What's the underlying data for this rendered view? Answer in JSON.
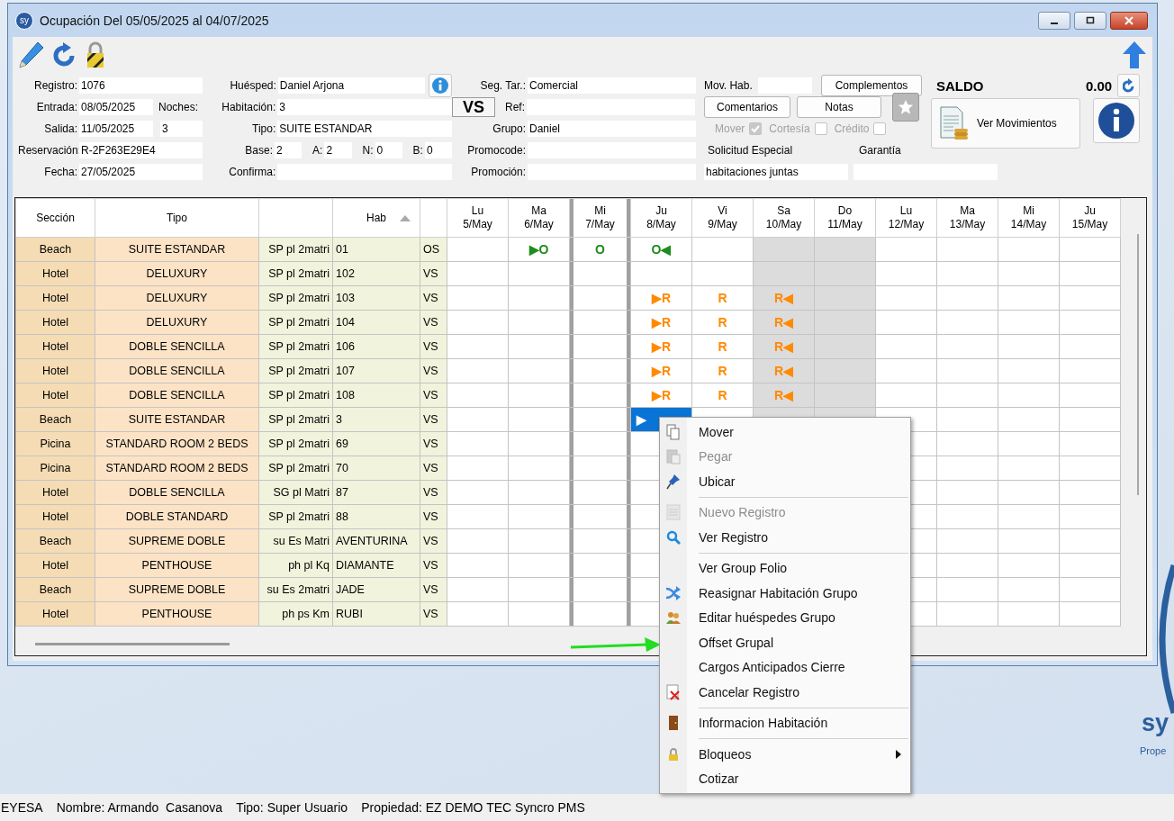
{
  "window": {
    "badge": "sy",
    "title": "Ocupación Del 05/05/2025 al 04/07/2025"
  },
  "form": {
    "registro": {
      "label": "Registro:",
      "value": "1076"
    },
    "entrada": {
      "label": "Entrada:",
      "value": "08/05/2025"
    },
    "noches": {
      "label": "Noches:",
      "value": "3"
    },
    "salida": {
      "label": "Salida:",
      "value": "11/05/2025"
    },
    "reservacion": {
      "label": "Reservación:",
      "value": "R-2F263E29E4"
    },
    "fecha": {
      "label": "Fecha:",
      "value": "27/05/2025"
    },
    "huesped": {
      "label": "Huésped:",
      "value": "Daniel Arjona"
    },
    "habitacion": {
      "label": "Habitación:",
      "value": "3"
    },
    "tipo": {
      "label": "Tipo:",
      "value": "SUITE ESTANDAR"
    },
    "occupancy": [
      {
        "label": "Base:",
        "value": "2"
      },
      {
        "label": "A:",
        "value": "2"
      },
      {
        "label": "N:",
        "value": "0"
      },
      {
        "label": "B:",
        "value": "0"
      }
    ],
    "confirma": {
      "label": "Confirma:"
    },
    "seg_tar": {
      "label": "Seg. Tar.:",
      "value": "Comercial"
    },
    "status_code": "VS",
    "ref": {
      "label": "Ref:"
    },
    "grupo": {
      "label": "Grupo:",
      "value": "Daniel"
    },
    "promocode": {
      "label": "Promocode:"
    },
    "promocion": {
      "label": "Promoción:"
    },
    "mov_hab": {
      "label": "Mov. Hab."
    },
    "buttons": {
      "complementos": "Complementos",
      "comentarios": "Comentarios",
      "notas": "Notas",
      "ver_movimientos": "Ver Movimientos"
    },
    "checks": [
      {
        "label": "Mover",
        "checked": true,
        "disabled": true
      },
      {
        "label": "Cortesía",
        "checked": false,
        "disabled": true
      },
      {
        "label": "Crédito",
        "checked": false,
        "disabled": true
      }
    ],
    "solicitud": {
      "label": "Solicitud Especial",
      "value": "habitaciones juntas"
    },
    "garantia": {
      "label": "Garantía"
    },
    "saldo": {
      "label": "SALDO",
      "value": "0.00"
    }
  },
  "grid": {
    "columns": {
      "seccion": "Sección",
      "tipo": "Tipo",
      "hab": {
        "label": "Hab",
        "sorted": true
      }
    },
    "days": [
      {
        "weekday": "Lu",
        "date": "5/May",
        "weekend": false,
        "marked": false
      },
      {
        "weekday": "Ma",
        "date": "6/May",
        "weekend": false,
        "marked": false
      },
      {
        "weekday": "Mi",
        "date": "7/May",
        "weekend": false,
        "marked": true
      },
      {
        "weekday": "Ju",
        "date": "8/May",
        "weekend": false,
        "marked": false
      },
      {
        "weekday": "Vi",
        "date": "9/May",
        "weekend": false,
        "marked": false
      },
      {
        "weekday": "Sa",
        "date": "10/May",
        "weekend": true,
        "marked": false
      },
      {
        "weekday": "Do",
        "date": "11/May",
        "weekend": true,
        "marked": false
      },
      {
        "weekday": "Lu",
        "date": "12/May",
        "weekend": false,
        "marked": false
      },
      {
        "weekday": "Ma",
        "date": "13/May",
        "weekend": false,
        "marked": false
      },
      {
        "weekday": "Mi",
        "date": "14/May",
        "weekend": false,
        "marked": false
      },
      {
        "weekday": "Ju",
        "date": "15/May",
        "weekend": false,
        "marked": false
      }
    ],
    "rows": [
      {
        "seccion": "Beach",
        "tipo": "SUITE ESTANDAR",
        "column_3": "SP pl 2matri",
        "hab": "01",
        "column_5": "OS",
        "booking": {
          "color": "#1e8c1e",
          "selected": false,
          "cells": [
            "",
            "▶O",
            "O",
            "O◀"
          ]
        }
      },
      {
        "seccion": "Hotel",
        "tipo": "DELUXURY",
        "column_3": "SP pl 2matri",
        "hab": "102",
        "column_5": "VS"
      },
      {
        "seccion": "Hotel",
        "tipo": "DELUXURY",
        "column_3": "SP pl 2matri",
        "hab": "103",
        "column_5": "VS",
        "booking": {
          "color": "#ff8a00",
          "selected": false,
          "cells": [
            "",
            "",
            "",
            "▶R",
            "R",
            "R◀"
          ]
        }
      },
      {
        "seccion": "Hotel",
        "tipo": "DELUXURY",
        "column_3": "SP pl 2matri",
        "hab": "104",
        "column_5": "VS",
        "booking": {
          "color": "#ff8a00",
          "selected": false,
          "cells": [
            "",
            "",
            "",
            "▶R",
            "R",
            "R◀"
          ]
        }
      },
      {
        "seccion": "Hotel",
        "tipo": "DOBLE SENCILLA",
        "column_3": "SP pl 2matri",
        "hab": "106",
        "column_5": "VS",
        "booking": {
          "color": "#ff8a00",
          "selected": false,
          "cells": [
            "",
            "",
            "",
            "▶R",
            "R",
            "R◀"
          ]
        }
      },
      {
        "seccion": "Hotel",
        "tipo": "DOBLE SENCILLA",
        "column_3": "SP pl 2matri",
        "hab": "107",
        "column_5": "VS",
        "booking": {
          "color": "#ff8a00",
          "selected": false,
          "cells": [
            "",
            "",
            "",
            "▶R",
            "R",
            "R◀"
          ]
        }
      },
      {
        "seccion": "Hotel",
        "tipo": "DOBLE SENCILLA",
        "column_3": "SP pl 2matri",
        "hab": "108",
        "column_5": "VS",
        "booking": {
          "color": "#ff8a00",
          "selected": false,
          "cells": [
            "",
            "",
            "",
            "▶R",
            "R",
            "R◀"
          ]
        }
      },
      {
        "seccion": "Beach",
        "tipo": "SUITE ESTANDAR",
        "column_3": "SP pl 2matri",
        "hab": "3",
        "column_5": "VS",
        "booking": {
          "selected": true,
          "cells": [
            "",
            "",
            "",
            "▶"
          ]
        }
      },
      {
        "seccion": "Picina",
        "tipo": "STANDARD ROOM 2 BEDS",
        "column_3": "SP pl 2matri",
        "hab": "69",
        "column_5": "VS"
      },
      {
        "seccion": "Picina",
        "tipo": "STANDARD ROOM 2 BEDS",
        "column_3": "SP pl 2matri",
        "hab": "70",
        "column_5": "VS"
      },
      {
        "seccion": "Hotel",
        "tipo": "DOBLE SENCILLA",
        "column_3": "SG pl Matri",
        "hab": "87",
        "column_5": "VS"
      },
      {
        "seccion": "Hotel",
        "tipo": "DOBLE STANDARD",
        "column_3": "SP pl 2matri",
        "hab": "88",
        "column_5": "VS"
      },
      {
        "seccion": "Beach",
        "tipo": "SUPREME DOBLE",
        "column_3": "su Es Matri",
        "hab": "AVENTURINA",
        "column_5": "VS"
      },
      {
        "seccion": "Hotel",
        "tipo": "PENTHOUSE",
        "column_3": "ph pl Kq",
        "hab": "DIAMANTE",
        "column_5": "VS"
      },
      {
        "seccion": "Beach",
        "tipo": "SUPREME DOBLE",
        "column_3": "su Es 2matri",
        "hab": "JADE",
        "column_5": "VS"
      },
      {
        "seccion": "Hotel",
        "tipo": "PENTHOUSE",
        "column_3": "ph ps Km",
        "hab": "RUBI",
        "column_5": "VS"
      }
    ]
  },
  "context_menu": {
    "groups": [
      [
        {
          "label": "Mover",
          "disabled": false,
          "submenu": false
        },
        {
          "label": "Pegar",
          "disabled": true,
          "submenu": false
        },
        {
          "label": "Ubicar",
          "disabled": false,
          "submenu": false
        }
      ],
      [
        {
          "label": "Nuevo Registro",
          "disabled": true,
          "submenu": false
        },
        {
          "label": "Ver Registro",
          "disabled": false,
          "submenu": false
        }
      ],
      [
        {
          "label": "Ver Group Folio",
          "disabled": false,
          "submenu": false
        },
        {
          "label": "Reasignar Habitación Grupo",
          "disabled": false,
          "submenu": false
        },
        {
          "label": "Editar huéspedes Grupo",
          "disabled": false,
          "submenu": false
        },
        {
          "label": "Offset Grupal",
          "disabled": false,
          "submenu": false
        },
        {
          "label": "Cargos Anticipados Cierre",
          "disabled": false,
          "submenu": false
        },
        {
          "label": "Cancelar Registro",
          "disabled": false,
          "submenu": false
        }
      ],
      [
        {
          "label": "Informacion Habitación",
          "disabled": false,
          "submenu": false
        }
      ],
      [
        {
          "label": "Bloqueos",
          "disabled": false,
          "submenu": true
        },
        {
          "label": "Cotizar",
          "disabled": false,
          "submenu": false
        }
      ]
    ]
  },
  "status_bar": [
    "EYESA",
    "Nombre: Armando  Casanova",
    "Tipo: Super Usuario",
    "Propiedad: EZ DEMO TEC Syncro PMS"
  ],
  "desktop": {
    "logo_text": "sy",
    "tagline": "Prope"
  }
}
